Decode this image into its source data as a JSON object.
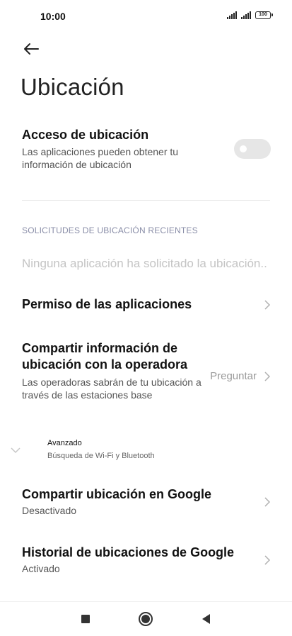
{
  "status_bar": {
    "time": "10:00",
    "battery": "100"
  },
  "page": {
    "title": "Ubicación"
  },
  "location_access": {
    "title": "Acceso de ubicación",
    "subtitle": "Las aplicaciones pueden obtener tu información de ubicación",
    "enabled": false
  },
  "recent_requests": {
    "header": "SOLICITUDES DE UBICACIÓN RECIENTES",
    "empty_text": "Ninguna aplicación ha solicitado la ubicación.."
  },
  "app_permissions": {
    "title": "Permiso de las aplicaciones"
  },
  "carrier_share": {
    "title": "Compartir información de ubicación con la operadora",
    "subtitle": "Las operadoras sabrán de tu ubicación a través de las estaciones base",
    "value": "Preguntar"
  },
  "advanced": {
    "title": "Avanzado",
    "subtitle": "Búsqueda de Wi-Fi y Bluetooth"
  },
  "google_share": {
    "title": "Compartir ubicación en Google",
    "subtitle": "Desactivado"
  },
  "google_history": {
    "title": "Historial de ubicaciones de Google",
    "subtitle": "Activado"
  },
  "colors": {
    "toggle_off": "#e6e6e6",
    "section_header": "#8a8ea8",
    "empty_text": "#c4c4c4"
  },
  "icons": {
    "back": "arrow-left-icon",
    "chevron": "chevron-right-icon",
    "expand": "chevron-down-icon",
    "nav_recents": "square-icon",
    "nav_home": "circle-icon",
    "nav_back": "triangle-left-icon"
  }
}
